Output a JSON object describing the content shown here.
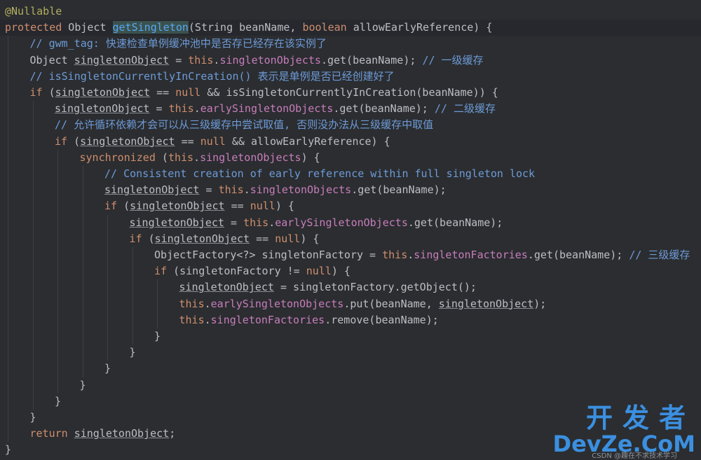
{
  "code": {
    "lines": [
      {
        "indent": 0,
        "tokens": [
          {
            "t": "@Nullable",
            "c": "ann"
          }
        ]
      },
      {
        "indent": 0,
        "current": true,
        "tokens": [
          {
            "t": "protected",
            "c": "kw"
          },
          {
            "t": " Object ",
            "c": ""
          },
          {
            "t": "getSingleton",
            "c": "fn hl"
          },
          {
            "t": "(String beanName, ",
            "c": ""
          },
          {
            "t": "boolean",
            "c": "kw"
          },
          {
            "t": " allowEarlyReference) {",
            "c": ""
          }
        ]
      },
      {
        "indent": 1,
        "tokens": [
          {
            "t": "// gwm_tag: 快速检查单例缓冲池中是否存已经存在该实例了",
            "c": "cmt"
          }
        ]
      },
      {
        "indent": 1,
        "tokens": [
          {
            "t": "Object ",
            "c": ""
          },
          {
            "t": "singletonObject",
            "c": "lm"
          },
          {
            "t": " = ",
            "c": ""
          },
          {
            "t": "this",
            "c": "kw"
          },
          {
            "t": ".",
            "c": ""
          },
          {
            "t": "singletonObjects",
            "c": "fld"
          },
          {
            "t": ".get(beanName); ",
            "c": ""
          },
          {
            "t": "// 一级缓存",
            "c": "cmt"
          }
        ]
      },
      {
        "indent": 1,
        "tokens": [
          {
            "t": "// isSingletonCurrentlyInCreation() 表示是单例是否已经创建好了",
            "c": "cmt"
          }
        ]
      },
      {
        "indent": 1,
        "tokens": [
          {
            "t": "if",
            "c": "kw"
          },
          {
            "t": " (",
            "c": ""
          },
          {
            "t": "singletonObject",
            "c": "lm"
          },
          {
            "t": " == ",
            "c": ""
          },
          {
            "t": "null",
            "c": "kw"
          },
          {
            "t": " && isSingletonCurrentlyInCreation(beanName)) {",
            "c": ""
          }
        ]
      },
      {
        "indent": 2,
        "tokens": [
          {
            "t": "singletonObject",
            "c": "lm"
          },
          {
            "t": " = ",
            "c": ""
          },
          {
            "t": "this",
            "c": "kw"
          },
          {
            "t": ".",
            "c": ""
          },
          {
            "t": "earlySingletonObjects",
            "c": "fld"
          },
          {
            "t": ".get(beanName); ",
            "c": ""
          },
          {
            "t": "// 二级缓存",
            "c": "cmt"
          }
        ]
      },
      {
        "indent": 2,
        "tokens": [
          {
            "t": "// 允许循环依赖才会可以从三级缓存中尝试取值, 否则没办法从三级缓存中取值",
            "c": "cmt"
          }
        ]
      },
      {
        "indent": 2,
        "tokens": [
          {
            "t": "if",
            "c": "kw"
          },
          {
            "t": " (",
            "c": ""
          },
          {
            "t": "singletonObject",
            "c": "lm"
          },
          {
            "t": " == ",
            "c": ""
          },
          {
            "t": "null",
            "c": "kw"
          },
          {
            "t": " && allowEarlyReference) {",
            "c": ""
          }
        ]
      },
      {
        "indent": 3,
        "tokens": [
          {
            "t": "synchronized",
            "c": "kw"
          },
          {
            "t": " (",
            "c": ""
          },
          {
            "t": "this",
            "c": "kw"
          },
          {
            "t": ".",
            "c": ""
          },
          {
            "t": "singletonObjects",
            "c": "fld"
          },
          {
            "t": ") {",
            "c": ""
          }
        ]
      },
      {
        "indent": 4,
        "tokens": [
          {
            "t": "// Consistent creation of early reference within full singleton lock",
            "c": "cmt"
          }
        ]
      },
      {
        "indent": 4,
        "tokens": [
          {
            "t": "singletonObject",
            "c": "lm"
          },
          {
            "t": " = ",
            "c": ""
          },
          {
            "t": "this",
            "c": "kw"
          },
          {
            "t": ".",
            "c": ""
          },
          {
            "t": "singletonObjects",
            "c": "fld"
          },
          {
            "t": ".get(beanName);",
            "c": ""
          }
        ]
      },
      {
        "indent": 4,
        "tokens": [
          {
            "t": "if",
            "c": "kw"
          },
          {
            "t": " (",
            "c": ""
          },
          {
            "t": "singletonObject",
            "c": "lm"
          },
          {
            "t": " == ",
            "c": ""
          },
          {
            "t": "null",
            "c": "kw"
          },
          {
            "t": ") {",
            "c": ""
          }
        ]
      },
      {
        "indent": 5,
        "tokens": [
          {
            "t": "singletonObject",
            "c": "lm"
          },
          {
            "t": " = ",
            "c": ""
          },
          {
            "t": "this",
            "c": "kw"
          },
          {
            "t": ".",
            "c": ""
          },
          {
            "t": "earlySingletonObjects",
            "c": "fld"
          },
          {
            "t": ".get(beanName);",
            "c": ""
          }
        ]
      },
      {
        "indent": 5,
        "tokens": [
          {
            "t": "if",
            "c": "kw"
          },
          {
            "t": " (",
            "c": ""
          },
          {
            "t": "singletonObject",
            "c": "lm"
          },
          {
            "t": " == ",
            "c": ""
          },
          {
            "t": "null",
            "c": "kw"
          },
          {
            "t": ") {",
            "c": ""
          }
        ]
      },
      {
        "indent": 6,
        "tokens": [
          {
            "t": "ObjectFactory<?> singletonFactory = ",
            "c": ""
          },
          {
            "t": "this",
            "c": "kw"
          },
          {
            "t": ".",
            "c": ""
          },
          {
            "t": "singletonFactories",
            "c": "fld"
          },
          {
            "t": ".get(beanName); ",
            "c": ""
          },
          {
            "t": "// 三级缓存",
            "c": "cmt"
          }
        ]
      },
      {
        "indent": 6,
        "tokens": [
          {
            "t": "if",
            "c": "kw"
          },
          {
            "t": " (singletonFactory != ",
            "c": ""
          },
          {
            "t": "null",
            "c": "kw"
          },
          {
            "t": ") {",
            "c": ""
          }
        ]
      },
      {
        "indent": 7,
        "tokens": [
          {
            "t": "singletonObject",
            "c": "lm"
          },
          {
            "t": " = singletonFactory.getObject();",
            "c": ""
          }
        ]
      },
      {
        "indent": 7,
        "tokens": [
          {
            "t": "this",
            "c": "kw"
          },
          {
            "t": ".",
            "c": ""
          },
          {
            "t": "earlySingletonObjects",
            "c": "fld"
          },
          {
            "t": ".put(beanName, ",
            "c": ""
          },
          {
            "t": "singletonObject",
            "c": "lm"
          },
          {
            "t": ");",
            "c": ""
          }
        ]
      },
      {
        "indent": 7,
        "tokens": [
          {
            "t": "this",
            "c": "kw"
          },
          {
            "t": ".",
            "c": ""
          },
          {
            "t": "singletonFactories",
            "c": "fld"
          },
          {
            "t": ".remove(beanName);",
            "c": ""
          }
        ]
      },
      {
        "indent": 6,
        "tokens": [
          {
            "t": "}",
            "c": ""
          }
        ]
      },
      {
        "indent": 5,
        "tokens": [
          {
            "t": "}",
            "c": ""
          }
        ]
      },
      {
        "indent": 4,
        "tokens": [
          {
            "t": "}",
            "c": ""
          }
        ]
      },
      {
        "indent": 3,
        "tokens": [
          {
            "t": "}",
            "c": ""
          }
        ]
      },
      {
        "indent": 2,
        "tokens": [
          {
            "t": "}",
            "c": ""
          }
        ]
      },
      {
        "indent": 1,
        "tokens": [
          {
            "t": "}",
            "c": ""
          }
        ]
      },
      {
        "indent": 1,
        "tokens": [
          {
            "t": "return",
            "c": "kw"
          },
          {
            "t": " ",
            "c": ""
          },
          {
            "t": "singletonObject",
            "c": "lm"
          },
          {
            "t": ";",
            "c": ""
          }
        ]
      },
      {
        "indent": 0,
        "tokens": [
          {
            "t": "}",
            "c": ""
          }
        ]
      }
    ]
  },
  "watermark": {
    "cn": "开发者",
    "en": "DevZe.CoM",
    "small": "CSDN @趣在不求技术学习"
  },
  "colors": {
    "background": "#2b2d30",
    "keyword": "#cf8e6d",
    "function": "#56a8f5",
    "field": "#c77dbb",
    "comment": "#6e9bd8",
    "annotation": "#b3ae60",
    "watermark": "#3b8fe0"
  }
}
